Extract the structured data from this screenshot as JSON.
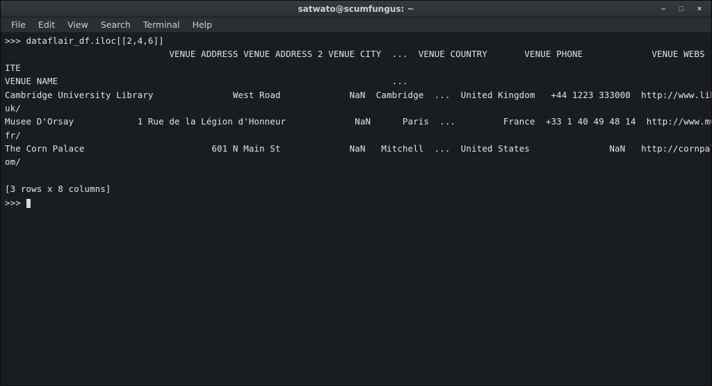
{
  "window": {
    "title": "satwato@scumfungus: ~",
    "controls": {
      "min": "–",
      "max": "□",
      "close": "×"
    }
  },
  "menu": {
    "file": "File",
    "edit": "Edit",
    "view": "View",
    "search": "Search",
    "terminal": "Terminal",
    "help": "Help"
  },
  "terminal": {
    "prompt_line": ">>> dataflair_df.iloc[[2,4,6]]",
    "header_line": "                               VENUE ADDRESS VENUE ADDRESS 2 VENUE CITY  ...  VENUE COUNTRY       VENUE PHONE             VENUE WEBS",
    "ite_line": "ITE",
    "name_line": "VENUE NAME                                                               ...",
    "row1a": "Cambridge University Library               West Road             NaN  Cambridge  ...  United Kingdom   +44 1223 333000  http://www.lib.cam.ac.",
    "row1b": "uk/",
    "row2a": "Musee D'Orsay            1 Rue de la Légion d'Honneur             NaN      Paris  ...         France  +33 1 40 49 48 14  http://www.musee-orsay.",
    "row2b": "fr/",
    "row3a": "The Corn Palace                        601 N Main St             NaN   Mitchell  ...  United States               NaN   http://cornpalace.c",
    "row3b": "om/",
    "blank": "",
    "summary": "[3 rows x 8 columns]",
    "prompt2": ">>> "
  },
  "chart_data": {
    "type": "table",
    "command": "dataflair_df.iloc[[2,4,6]]",
    "columns_visible": [
      "VENUE NAME",
      "VENUE ADDRESS",
      "VENUE ADDRESS 2",
      "VENUE CITY",
      "...",
      "VENUE COUNTRY",
      "VENUE PHONE",
      "VENUE WEBSITE"
    ],
    "rows": [
      {
        "VENUE NAME": "Cambridge University Library",
        "VENUE ADDRESS": "West Road",
        "VENUE ADDRESS 2": "NaN",
        "VENUE CITY": "Cambridge",
        "VENUE COUNTRY": "United Kingdom",
        "VENUE PHONE": "+44 1223 333000",
        "VENUE WEBSITE": "http://www.lib.cam.ac.uk/"
      },
      {
        "VENUE NAME": "Musee D'Orsay",
        "VENUE ADDRESS": "1 Rue de la Légion d'Honneur",
        "VENUE ADDRESS 2": "NaN",
        "VENUE CITY": "Paris",
        "VENUE COUNTRY": "France",
        "VENUE PHONE": "+33 1 40 49 48 14",
        "VENUE WEBSITE": "http://www.musee-orsay.fr/"
      },
      {
        "VENUE NAME": "The Corn Palace",
        "VENUE ADDRESS": "601 N Main St",
        "VENUE ADDRESS 2": "NaN",
        "VENUE CITY": "Mitchell",
        "VENUE COUNTRY": "United States",
        "VENUE PHONE": "NaN",
        "VENUE WEBSITE": "http://cornpalace.com/"
      }
    ],
    "shape_summary": "[3 rows x 8 columns]"
  }
}
